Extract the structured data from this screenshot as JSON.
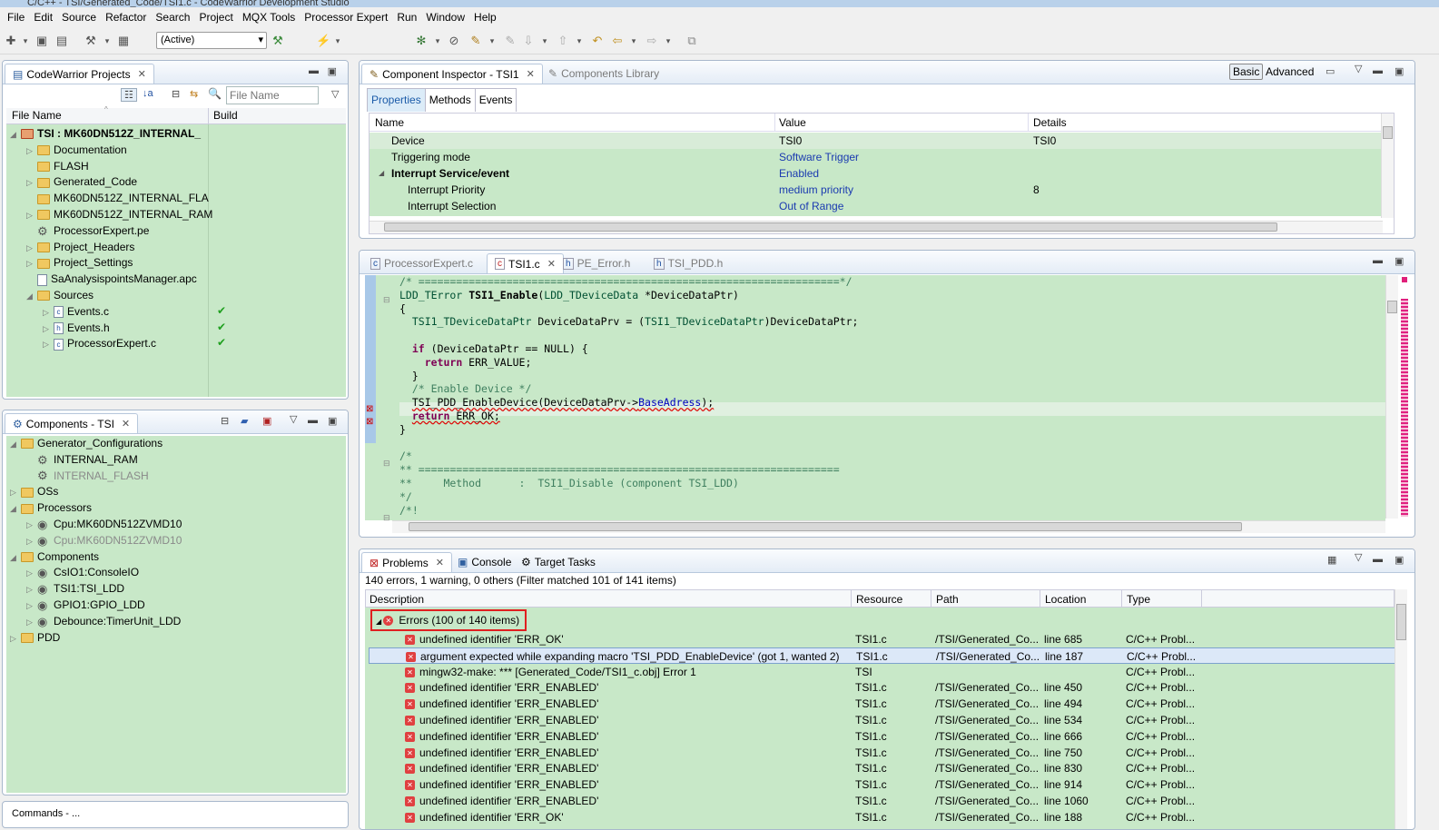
{
  "window": {
    "title": "C/C++ - TSI/Generated_Code/TSI1.c - CodeWarrior Development Studio"
  },
  "menu": [
    "File",
    "Edit",
    "Source",
    "Refactor",
    "Search",
    "Project",
    "MQX Tools",
    "Processor Expert",
    "Run",
    "Window",
    "Help"
  ],
  "toolbar": {
    "config": "(Active)"
  },
  "projects": {
    "tab": "CodeWarrior Projects",
    "filter_placeholder": "File Name",
    "col_name": "File Name",
    "col_build": "Build",
    "items": [
      {
        "label": "TSI : MK60DN512Z_INTERNAL_",
        "bold": true,
        "depth": 0,
        "fold": "◢",
        "icon": "project"
      },
      {
        "label": "Documentation",
        "depth": 1,
        "fold": "▷",
        "icon": "folder"
      },
      {
        "label": "FLASH",
        "depth": 1,
        "fold": "",
        "icon": "folder"
      },
      {
        "label": "Generated_Code",
        "depth": 1,
        "fold": "▷",
        "icon": "folder"
      },
      {
        "label": "MK60DN512Z_INTERNAL_FLA",
        "depth": 1,
        "fold": "",
        "icon": "folder"
      },
      {
        "label": "MK60DN512Z_INTERNAL_RAM",
        "depth": 1,
        "fold": "▷",
        "icon": "folder"
      },
      {
        "label": "ProcessorExpert.pe",
        "depth": 1,
        "fold": "",
        "icon": "gear"
      },
      {
        "label": "Project_Headers",
        "depth": 1,
        "fold": "▷",
        "icon": "folder"
      },
      {
        "label": "Project_Settings",
        "depth": 1,
        "fold": "▷",
        "icon": "folder"
      },
      {
        "label": "SaAnalysispointsManager.apc",
        "depth": 1,
        "fold": "",
        "icon": "file"
      },
      {
        "label": "Sources",
        "depth": 1,
        "fold": "◢",
        "icon": "folder"
      },
      {
        "label": "Events.c",
        "depth": 2,
        "fold": "▷",
        "icon": "c",
        "check": true
      },
      {
        "label": "Events.h",
        "depth": 2,
        "fold": "▷",
        "icon": "h",
        "check": true
      },
      {
        "label": "ProcessorExpert.c",
        "depth": 2,
        "fold": "▷",
        "icon": "c",
        "check": true
      }
    ]
  },
  "components": {
    "tab": "Components - TSI",
    "items": [
      {
        "label": "Generator_Configurations",
        "depth": 0,
        "fold": "◢",
        "icon": "folder"
      },
      {
        "label": "INTERNAL_RAM",
        "depth": 1,
        "fold": "",
        "icon": "gear"
      },
      {
        "label": "INTERNAL_FLASH",
        "depth": 1,
        "fold": "",
        "icon": "gear",
        "grey": true
      },
      {
        "label": "OSs",
        "depth": 0,
        "fold": "▷",
        "icon": "folder"
      },
      {
        "label": "Processors",
        "depth": 0,
        "fold": "◢",
        "icon": "folder"
      },
      {
        "label": "Cpu:MK60DN512ZVMD10",
        "depth": 1,
        "fold": "▷",
        "icon": "chip"
      },
      {
        "label": "Cpu:MK60DN512ZVMD10",
        "depth": 1,
        "fold": "▷",
        "icon": "chip",
        "grey": true
      },
      {
        "label": "Components",
        "depth": 0,
        "fold": "◢",
        "icon": "folder"
      },
      {
        "label": "CsIO1:ConsoleIO",
        "depth": 1,
        "fold": "▷",
        "icon": "chip"
      },
      {
        "label": "TSI1:TSI_LDD",
        "depth": 1,
        "fold": "▷",
        "icon": "chip"
      },
      {
        "label": "GPIO1:GPIO_LDD",
        "depth": 1,
        "fold": "▷",
        "icon": "chip"
      },
      {
        "label": "Debounce:TimerUnit_LDD",
        "depth": 1,
        "fold": "▷",
        "icon": "chip"
      },
      {
        "label": "PDD",
        "depth": 0,
        "fold": "▷",
        "icon": "folder"
      }
    ]
  },
  "inspector": {
    "tab": "Component Inspector - TSI1",
    "tab2": "Components Library",
    "basic": "Basic",
    "advanced": "Advanced",
    "subtabs": [
      "Properties",
      "Methods",
      "Events"
    ],
    "cols": [
      "Name",
      "Value",
      "Details"
    ],
    "rows": [
      {
        "name": "Device",
        "value": "TSI0",
        "details": "TSI0",
        "indent": 1,
        "plain": true
      },
      {
        "name": "Triggering mode",
        "value": "Software Trigger",
        "details": "",
        "indent": 1
      },
      {
        "name": "Interrupt Service/event",
        "value": "Enabled",
        "details": "",
        "indent": 0,
        "bold": true
      },
      {
        "name": "Interrupt Priority",
        "value": "medium priority",
        "details": "8",
        "indent": 2
      },
      {
        "name": "Interrupt Selection",
        "value": "Out of Range",
        "details": "",
        "indent": 2
      }
    ]
  },
  "editor": {
    "tabs": [
      "ProcessorExpert.c",
      "TSI1.c",
      "PE_Error.h",
      "TSI_PDD.h"
    ],
    "active": 1
  },
  "problems": {
    "tab": "Problems",
    "tab2": "Console",
    "tab3": "Target Tasks",
    "summary": "140 errors, 1 warning, 0 others (Filter matched 101 of 141 items)",
    "cols": [
      "Description",
      "Resource",
      "Path",
      "Location",
      "Type"
    ],
    "group": "Errors (100 of 140 items)",
    "rows": [
      {
        "desc": " undefined identifier 'ERR_OK'",
        "res": "TSI1.c",
        "path": "/TSI/Generated_Co...",
        "loc": "line 685",
        "type": "C/C++ Probl..."
      },
      {
        "desc": "argument expected while expanding macro 'TSI_PDD_EnableDevice' (got 1, wanted 2)",
        "res": "TSI1.c",
        "path": "/TSI/Generated_Co...",
        "loc": "line 187",
        "type": "C/C++ Probl..."
      },
      {
        "desc": "mingw32-make: *** [Generated_Code/TSI1_c.obj] Error 1",
        "res": "TSI",
        "path": "",
        "loc": "",
        "type": "C/C++ Probl..."
      },
      {
        "desc": "undefined identifier 'ERR_ENABLED'",
        "res": "TSI1.c",
        "path": "/TSI/Generated_Co...",
        "loc": "line 450",
        "type": "C/C++ Probl..."
      },
      {
        "desc": "undefined identifier 'ERR_ENABLED'",
        "res": "TSI1.c",
        "path": "/TSI/Generated_Co...",
        "loc": "line 494",
        "type": "C/C++ Probl..."
      },
      {
        "desc": "undefined identifier 'ERR_ENABLED'",
        "res": "TSI1.c",
        "path": "/TSI/Generated_Co...",
        "loc": "line 534",
        "type": "C/C++ Probl..."
      },
      {
        "desc": "undefined identifier 'ERR_ENABLED'",
        "res": "TSI1.c",
        "path": "/TSI/Generated_Co...",
        "loc": "line 666",
        "type": "C/C++ Probl..."
      },
      {
        "desc": "undefined identifier 'ERR_ENABLED'",
        "res": "TSI1.c",
        "path": "/TSI/Generated_Co...",
        "loc": "line 750",
        "type": "C/C++ Probl..."
      },
      {
        "desc": "undefined identifier 'ERR_ENABLED'",
        "res": "TSI1.c",
        "path": "/TSI/Generated_Co...",
        "loc": "line 830",
        "type": "C/C++ Probl..."
      },
      {
        "desc": "undefined identifier 'ERR_ENABLED'",
        "res": "TSI1.c",
        "path": "/TSI/Generated_Co...",
        "loc": "line 914",
        "type": "C/C++ Probl..."
      },
      {
        "desc": "undefined identifier 'ERR_ENABLED'",
        "res": "TSI1.c",
        "path": "/TSI/Generated_Co...",
        "loc": "line 1060",
        "type": "C/C++ Probl..."
      },
      {
        "desc": "undefined identifier 'ERR_OK'",
        "res": "TSI1.c",
        "path": "/TSI/Generated_Co...",
        "loc": "line 188",
        "type": "C/C++ Probl..."
      }
    ]
  },
  "bottom_left": {
    "tab": "Commands - ..."
  }
}
